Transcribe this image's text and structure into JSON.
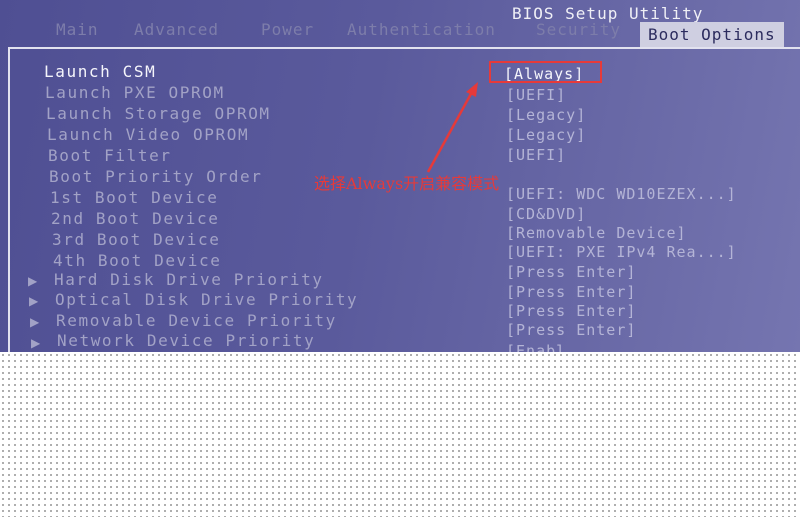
{
  "window": {
    "title": "BIOS Setup Utility"
  },
  "tabs": [
    {
      "label": "Main"
    },
    {
      "label": "Advanced"
    },
    {
      "label": "Power"
    },
    {
      "label": "Authentication"
    },
    {
      "label": "Security"
    },
    {
      "label": "Boot Options"
    }
  ],
  "settings": [
    {
      "label": "Launch CSM",
      "value": "[Always]"
    },
    {
      "label": "Launch PXE OPROM",
      "value": "[UEFI]"
    },
    {
      "label": "Launch Storage OPROM",
      "value": "[Legacy]"
    },
    {
      "label": "Launch Video OPROM",
      "value": "[Legacy]"
    },
    {
      "label": "Boot Filter",
      "value": "[UEFI]"
    },
    {
      "label": "Boot Priority Order",
      "value": ""
    },
    {
      "label": "1st Boot Device",
      "value": "[UEFI: WDC WD10EZEX...]"
    },
    {
      "label": "2nd Boot Device",
      "value": "[CD&DVD]"
    },
    {
      "label": "3rd Boot Device",
      "value": "[Removable Device]"
    },
    {
      "label": "4th Boot Device",
      "value": "[UEFI: PXE IPv4 Rea...]"
    },
    {
      "label": "Hard Disk Drive Priority",
      "value": "[Press Enter]"
    },
    {
      "label": "Optical Disk Drive Priority",
      "value": "[Press Enter]"
    },
    {
      "label": "Removable Device Priority",
      "value": "[Press Enter]"
    },
    {
      "label": "Network Device Priority",
      "value": "[Press Enter]"
    },
    {
      "label": "",
      "value": "[Enabl"
    }
  ],
  "annotation": {
    "text": "选择Always开启兼容模式",
    "color": "#e53a3a"
  },
  "colors": {
    "bios_background": "#5a5a9c",
    "highlight_border": "#e63a3a",
    "active_tab": "#cfcfe1"
  },
  "icons": {
    "submenu": "submenu-arrow-icon"
  }
}
